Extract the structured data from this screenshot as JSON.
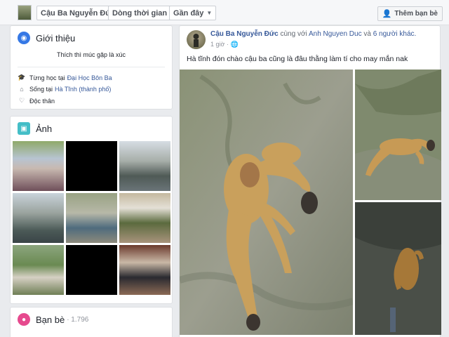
{
  "topbar": {
    "name_button": "Cậu Ba Nguyễn Đức",
    "timeline_button": "Dòng thời gian",
    "recent_button": "Gần đây",
    "add_friend_button": "Thêm bạn bè"
  },
  "intro": {
    "title": "Giới thiệu",
    "bio": "Thích thì múc gặp là xúc",
    "studied_prefix": "Từng học tại",
    "studied_place": "Đại Học Bôn Ba",
    "lives_prefix": "Sống tại",
    "lives_place": "Hà Tĩnh (thành phố)",
    "relationship": "Độc thân"
  },
  "photos": {
    "title": "Ảnh"
  },
  "friends": {
    "title": "Bạn bè",
    "count": "· 1.796"
  },
  "post": {
    "author": "Cậu Ba Nguyễn Đức",
    "with_text": "cùng với",
    "tagged": "Anh Nguyen Duc",
    "and_text": "và",
    "others": "6 người khác.",
    "time": "1 giờ ·",
    "text": "Hà tĩnh đón chào cậu ba cũng là đâu thằng làm tí cho may mắn nak"
  },
  "icons": {
    "intro": "globe-icon",
    "photos": "photo-icon",
    "friends": "people-icon",
    "studied": "school-icon",
    "lives": "home-icon",
    "relationship": "heart-icon",
    "audience": "globe-icon"
  },
  "colors": {
    "link": "#365899",
    "background": "#e9ebee",
    "intro_icon": "#3578e5",
    "photos_icon": "#44bec7",
    "friends_icon": "#e64a8e"
  }
}
